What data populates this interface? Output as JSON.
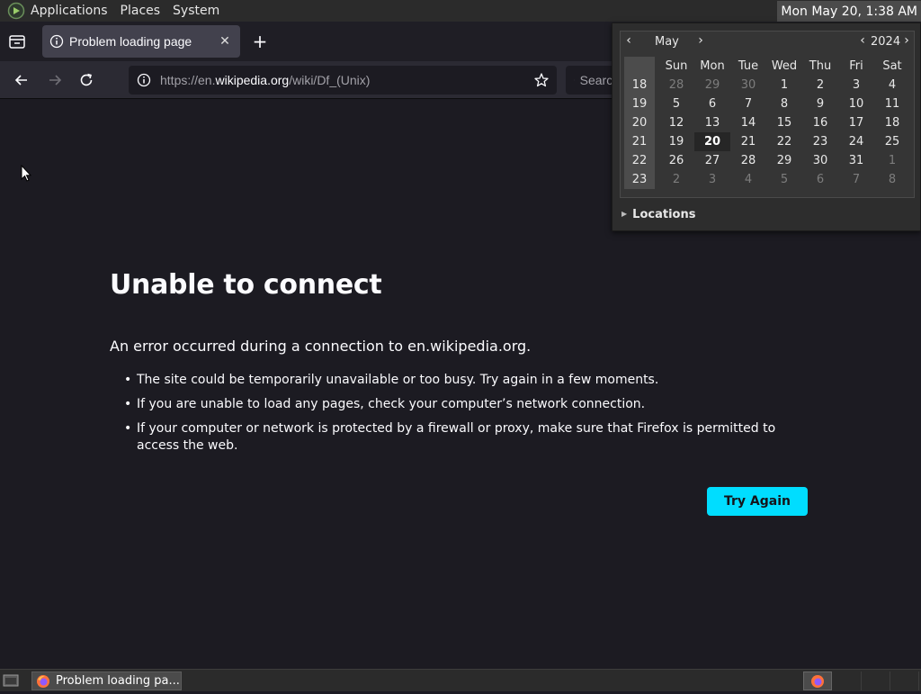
{
  "top_panel": {
    "menus": [
      "Applications",
      "Places",
      "System"
    ],
    "clock": "Mon May 20,  1:38 AM"
  },
  "browser": {
    "tab_title": "Problem loading page",
    "url_prefix": "https://en.",
    "url_domain": "wikipedia.org",
    "url_path": "/wiki/Df_(Unix)",
    "search_placeholder": "Search"
  },
  "error_page": {
    "title": "Unable to connect",
    "description": "An error occurred during a connection to en.wikipedia.org.",
    "bullets": [
      "The site could be temporarily unavailable or too busy. Try again in a few moments.",
      "If you are unable to load any pages, check your computer’s network connection.",
      "If your computer or network is protected by a firewall or proxy, make sure that Firefox is permitted to access the web."
    ],
    "try_again_label": "Try Again",
    "accent_color": "#00ddff"
  },
  "calendar": {
    "month": "May",
    "year": "2024",
    "weekdays": [
      "Sun",
      "Mon",
      "Tue",
      "Wed",
      "Thu",
      "Fri",
      "Sat"
    ],
    "weeks": [
      {
        "wk": "18",
        "days": [
          "28",
          "29",
          "30",
          "1",
          "2",
          "3",
          "4"
        ],
        "dim": [
          true,
          true,
          true,
          false,
          false,
          false,
          false
        ]
      },
      {
        "wk": "19",
        "days": [
          "5",
          "6",
          "7",
          "8",
          "9",
          "10",
          "11"
        ],
        "dim": [
          false,
          false,
          false,
          false,
          false,
          false,
          false
        ]
      },
      {
        "wk": "20",
        "days": [
          "12",
          "13",
          "14",
          "15",
          "16",
          "17",
          "18"
        ],
        "dim": [
          false,
          false,
          false,
          false,
          false,
          false,
          false
        ]
      },
      {
        "wk": "21",
        "days": [
          "19",
          "20",
          "21",
          "22",
          "23",
          "24",
          "25"
        ],
        "dim": [
          false,
          false,
          false,
          false,
          false,
          false,
          false
        ]
      },
      {
        "wk": "22",
        "days": [
          "26",
          "27",
          "28",
          "29",
          "30",
          "31",
          "1"
        ],
        "dim": [
          false,
          false,
          false,
          false,
          false,
          false,
          true
        ]
      },
      {
        "wk": "23",
        "days": [
          "2",
          "3",
          "4",
          "5",
          "6",
          "7",
          "8"
        ],
        "dim": [
          true,
          true,
          true,
          true,
          true,
          true,
          true
        ]
      }
    ],
    "today": "20",
    "locations_label": "Locations"
  },
  "bottom_panel": {
    "task_title": "Problem loading pa..."
  }
}
